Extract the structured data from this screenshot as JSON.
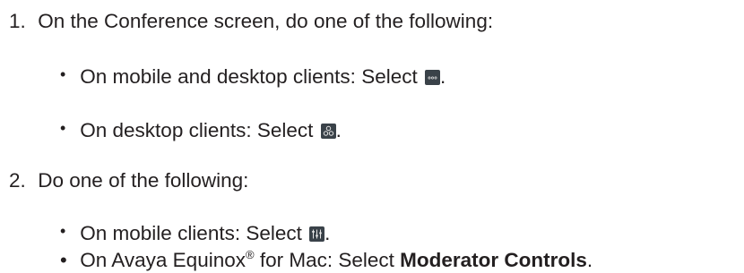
{
  "steps": [
    {
      "number": "1.",
      "text": "On the Conference screen, do one of the following:",
      "bullets": [
        {
          "text": "On mobile and desktop clients: Select ",
          "icon": "more-options-icon",
          "end": "."
        },
        {
          "text": "On desktop clients: Select ",
          "icon": "participants-icon",
          "end": "."
        }
      ]
    },
    {
      "number": "2.",
      "text": "Do one of the following:",
      "bullets": [
        {
          "text": "On mobile clients: Select ",
          "icon": "moderator-controls-icon",
          "end": "."
        },
        {
          "text": "On Avaya Equinox",
          "sup": "®",
          "mid": " for Mac: Select ",
          "bold": "Moderator Controls",
          "end": "."
        }
      ]
    }
  ],
  "bullet_char": "•",
  "text_color": "#231f20",
  "icon_bg_color": "#3a4249"
}
